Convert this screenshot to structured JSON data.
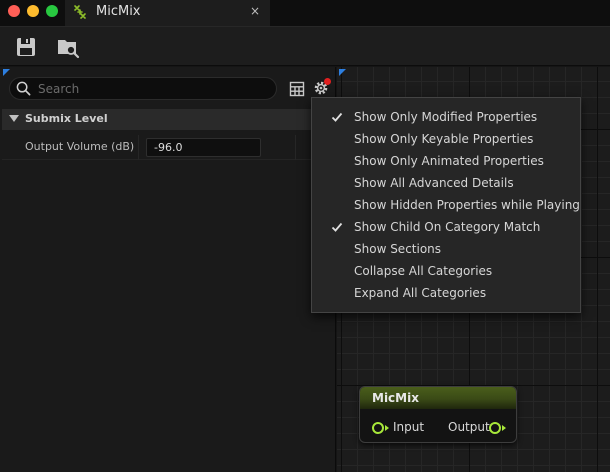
{
  "window": {
    "tab_title": "MicMix",
    "tab_close": "×",
    "tab_icon": "submix-icon"
  },
  "toolbar": {
    "buttons": [
      {
        "icon": "save-icon"
      },
      {
        "icon": "browse-asset-icon"
      }
    ]
  },
  "details": {
    "search": {
      "placeholder": "Search",
      "value": ""
    },
    "category": {
      "label": "Submix Level",
      "expanded": true
    },
    "properties": [
      {
        "label": "Output Volume (dB)",
        "value": "-96.0"
      }
    ],
    "settings_notification": true
  },
  "settings_menu": {
    "items": [
      {
        "label": "Show Only Modified Properties",
        "checked": true
      },
      {
        "label": "Show Only Keyable Properties",
        "checked": false
      },
      {
        "label": "Show Only Animated Properties",
        "checked": false
      },
      {
        "label": "Show All Advanced Details",
        "checked": false
      },
      {
        "label": "Show Hidden Properties while Playing",
        "checked": false
      },
      {
        "label": "Show Child On Category Match",
        "checked": true
      },
      {
        "label": "Show Sections",
        "checked": false
      },
      {
        "label": "Collapse All Categories",
        "checked": false
      },
      {
        "label": "Expand All Categories",
        "checked": false
      }
    ]
  },
  "graph": {
    "node": {
      "title": "MicMix",
      "input_label": "Input",
      "output_label": "Output",
      "header_color": "#4a5e1b",
      "pin_color": "#a8e83a"
    }
  },
  "colors": {
    "accent_blue": "#2d7fe0",
    "notification_red": "#e02020"
  }
}
